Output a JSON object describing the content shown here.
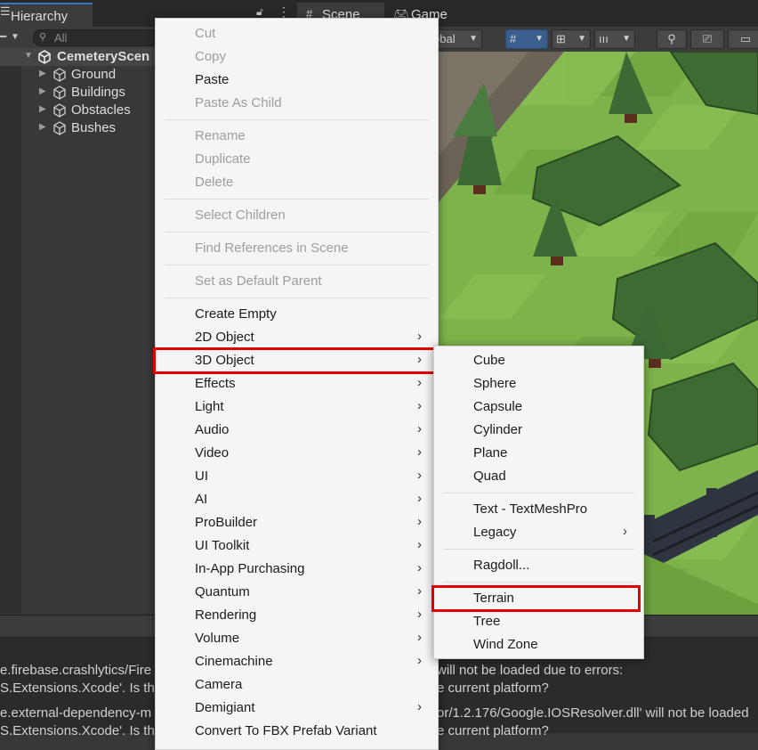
{
  "hierarchy": {
    "tab_title": "Hierarchy",
    "search_placeholder": "All",
    "scene_name": "CemeteryScen",
    "children": [
      "Ground",
      "Buildings",
      "Obstacles",
      "Bushes"
    ]
  },
  "scene_tabs": {
    "scene": "Scene",
    "game": "Game"
  },
  "scene_toolbar": {
    "global_label": "obal"
  },
  "context_menu": {
    "groups": [
      [
        {
          "label": "Cut",
          "enabled": false
        },
        {
          "label": "Copy",
          "enabled": false
        },
        {
          "label": "Paste",
          "enabled": true
        },
        {
          "label": "Paste As Child",
          "enabled": false
        }
      ],
      [
        {
          "label": "Rename",
          "enabled": false
        },
        {
          "label": "Duplicate",
          "enabled": false
        },
        {
          "label": "Delete",
          "enabled": false
        }
      ],
      [
        {
          "label": "Select Children",
          "enabled": false
        }
      ],
      [
        {
          "label": "Find References in Scene",
          "enabled": false
        }
      ],
      [
        {
          "label": "Set as Default Parent",
          "enabled": false
        }
      ],
      [
        {
          "label": "Create Empty",
          "enabled": true
        },
        {
          "label": "2D Object",
          "enabled": true,
          "submenu": true
        },
        {
          "label": "3D Object",
          "enabled": true,
          "submenu": true,
          "highlighted": true
        },
        {
          "label": "Effects",
          "enabled": true,
          "submenu": true
        },
        {
          "label": "Light",
          "enabled": true,
          "submenu": true
        },
        {
          "label": "Audio",
          "enabled": true,
          "submenu": true
        },
        {
          "label": "Video",
          "enabled": true,
          "submenu": true
        },
        {
          "label": "UI",
          "enabled": true,
          "submenu": true
        },
        {
          "label": "AI",
          "enabled": true,
          "submenu": true
        },
        {
          "label": "ProBuilder",
          "enabled": true,
          "submenu": true
        },
        {
          "label": "UI Toolkit",
          "enabled": true,
          "submenu": true
        },
        {
          "label": "In-App Purchasing",
          "enabled": true,
          "submenu": true
        },
        {
          "label": "Quantum",
          "enabled": true,
          "submenu": true
        },
        {
          "label": "Rendering",
          "enabled": true,
          "submenu": true
        },
        {
          "label": "Volume",
          "enabled": true,
          "submenu": true
        },
        {
          "label": "Cinemachine",
          "enabled": true,
          "submenu": true
        },
        {
          "label": "Camera",
          "enabled": true
        },
        {
          "label": "Demigiant",
          "enabled": true,
          "submenu": true
        },
        {
          "label": "Convert To FBX Prefab Variant",
          "enabled": true
        }
      ]
    ]
  },
  "submenu_3d": {
    "groups": [
      [
        {
          "label": "Cube"
        },
        {
          "label": "Sphere"
        },
        {
          "label": "Capsule"
        },
        {
          "label": "Cylinder"
        },
        {
          "label": "Plane"
        },
        {
          "label": "Quad"
        }
      ],
      [
        {
          "label": "Text - TextMeshPro"
        },
        {
          "label": "Legacy",
          "submenu": true
        }
      ],
      [
        {
          "label": "Ragdoll..."
        }
      ],
      [
        {
          "label": "Terrain",
          "highlighted": true
        },
        {
          "label": "Tree"
        },
        {
          "label": "Wind Zone"
        }
      ]
    ]
  },
  "console": {
    "lines": [
      {
        "left": "e.firebase.crashlytics/Fire",
        "right": "will not be loaded due to errors:"
      },
      {
        "left": "S.Extensions.Xcode'. Is th",
        "right": "e current platform?"
      },
      {
        "left": "e.external-dependency-m",
        "right": "or/1.2.176/Google.IOSResolver.dll' will not be loaded"
      },
      {
        "left": "S.Extensions.Xcode'. Is th",
        "right": "e current platform?"
      }
    ]
  },
  "colors": {
    "accent": "#3a79bb",
    "highlight_box": "#e00000",
    "grass": "#7db34a",
    "menu_bg": "#f5f5f5"
  }
}
